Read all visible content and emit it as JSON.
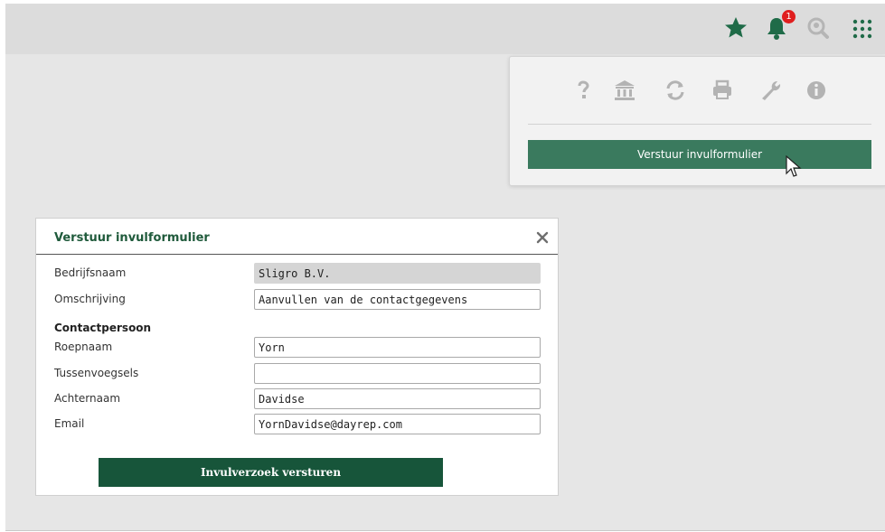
{
  "header": {
    "icons": {
      "favorites": "star-icon",
      "notifications": "bell-icon",
      "search": "search-location-icon",
      "apps": "apps-grid-icon"
    },
    "notification_count": "1"
  },
  "toolbar_menu": {
    "tools": [
      "help-icon",
      "bank-icon",
      "refresh-icon",
      "print-icon",
      "wrench-icon",
      "info-icon"
    ],
    "send_form_label": "Verstuur invulformulier"
  },
  "modal": {
    "title": "Verstuur invulformulier",
    "fields": {
      "company": {
        "label": "Bedrijfsnaam",
        "value": "Sligro B.V."
      },
      "description": {
        "label": "Omschrijving",
        "value": "Aanvullen van de contactgegevens"
      },
      "section_contact": "Contactpersoon",
      "first_name": {
        "label": "Roepnaam",
        "value": "Yorn"
      },
      "infix": {
        "label": "Tussenvoegsels",
        "value": ""
      },
      "last_name": {
        "label": "Achternaam",
        "value": "Davidse"
      },
      "email": {
        "label": "Email",
        "value": "YornDavidse@dayrep.com"
      }
    },
    "submit_label": "Invulverzoek versturen"
  },
  "colors": {
    "brand_green": "#17553a",
    "menu_button_green": "#3a7a5e",
    "icon_green": "#1f6b48",
    "badge_red": "#e01e1e",
    "tool_icon_gray": "#b3b3b3"
  }
}
